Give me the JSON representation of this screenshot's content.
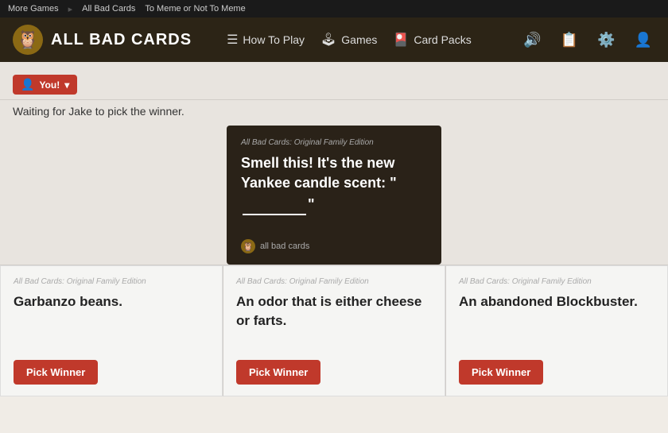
{
  "topbar": {
    "more_games": "More Games",
    "all_bad_cards": "All Bad Cards",
    "to_meme": "To Meme or Not To Meme"
  },
  "navbar": {
    "brand": "ALL BAD CARDS",
    "links": [
      {
        "id": "how-to-play",
        "icon": "☰",
        "label": "How To Play"
      },
      {
        "id": "games",
        "icon": "🎮",
        "label": "Games"
      },
      {
        "id": "card-packs",
        "icon": "🃏",
        "label": "Card Packs"
      }
    ],
    "icons": [
      {
        "id": "sound",
        "symbol": "🔊"
      },
      {
        "id": "list",
        "symbol": "📋"
      },
      {
        "id": "settings",
        "symbol": "⚙️"
      },
      {
        "id": "user",
        "symbol": "👤"
      }
    ]
  },
  "player": {
    "label": "You!",
    "icon": "👤"
  },
  "waiting_text": "Waiting for Jake to pick the winner.",
  "question_card": {
    "edition": "All Bad Cards: Original Family Edition",
    "text_before": "Smell this! It's the new Yankee candle scent: \"",
    "blank": "________",
    "text_after": "\"",
    "footer": "all bad cards"
  },
  "answer_cards": [
    {
      "edition": "All Bad Cards: Original Family Edition",
      "text": "Garbanzo beans.",
      "button_label": "Pick Winner"
    },
    {
      "edition": "All Bad Cards: Original Family Edition",
      "text": "An odor that is either cheese or farts.",
      "button_label": "Pick Winner"
    },
    {
      "edition": "All Bad Cards: Original Family Edition",
      "text": "An abandoned Blockbuster.",
      "button_label": "Pick Winner"
    }
  ]
}
